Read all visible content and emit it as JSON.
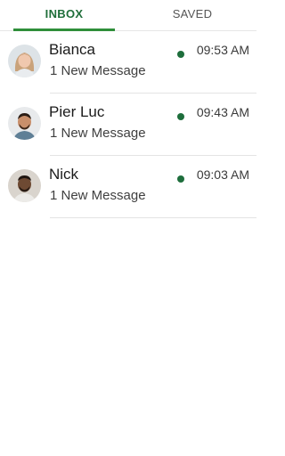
{
  "tabs": {
    "inbox_label": "INBOX",
    "saved_label": "SAVED",
    "active": "inbox"
  },
  "messages": [
    {
      "name": "Bianca",
      "preview": "1 New Message",
      "time": "09:53 AM",
      "unread": true,
      "avatar": "woman-avatar"
    },
    {
      "name": "Pier Luc",
      "preview": "1 New Message",
      "time": "09:43 AM",
      "unread": true,
      "avatar": "man-avatar"
    },
    {
      "name": "Nick",
      "preview": "1 New Message",
      "time": "09:03 AM",
      "unread": true,
      "avatar": "man-avatar"
    }
  ],
  "colors": {
    "accent": "#2f8f3a",
    "tab_active_text": "#1f6e3a",
    "unread_dot": "#1e6e3c"
  }
}
